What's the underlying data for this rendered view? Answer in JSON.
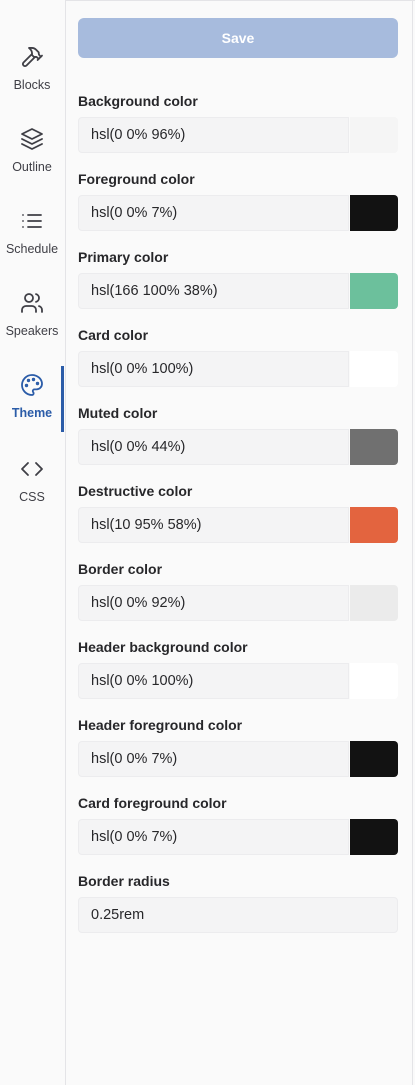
{
  "sidebar": {
    "items": [
      {
        "label": "Blocks",
        "icon": "hammer-icon"
      },
      {
        "label": "Outline",
        "icon": "layers-icon"
      },
      {
        "label": "Schedule",
        "icon": "list-icon"
      },
      {
        "label": "Speakers",
        "icon": "users-icon"
      },
      {
        "label": "Theme",
        "icon": "palette-icon",
        "active": true
      },
      {
        "label": "CSS",
        "icon": "code-icon"
      }
    ]
  },
  "toolbar": {
    "save_label": "Save"
  },
  "fields": [
    {
      "label": "Background color",
      "value": "hsl(0 0% 96%)",
      "swatch": "#f5f5f5"
    },
    {
      "label": "Foreground color",
      "value": "hsl(0 0% 7%)",
      "swatch": "#121212"
    },
    {
      "label": "Primary color",
      "value": "hsl(166 100% 38%)",
      "swatch": "#6cc09c"
    },
    {
      "label": "Card color",
      "value": "hsl(0 0% 100%)",
      "swatch": "#ffffff"
    },
    {
      "label": "Muted color",
      "value": "hsl(0 0% 44%)",
      "swatch": "#707070"
    },
    {
      "label": "Destructive color",
      "value": "hsl(10 95% 58%)",
      "swatch": "#e3643f"
    },
    {
      "label": "Border color",
      "value": "hsl(0 0% 92%)",
      "swatch": "#ebebeb"
    },
    {
      "label": "Header background color",
      "value": "hsl(0 0% 100%)",
      "swatch": "#ffffff"
    },
    {
      "label": "Header foreground color",
      "value": "hsl(0 0% 7%)",
      "swatch": "#121212"
    },
    {
      "label": "Card foreground color",
      "value": "hsl(0 0% 7%)",
      "swatch": "#121212"
    },
    {
      "label": "Border radius",
      "value": "0.25rem"
    }
  ],
  "colors": {
    "accent": "#2b5ca8",
    "save_button": "#a7bbdd"
  }
}
